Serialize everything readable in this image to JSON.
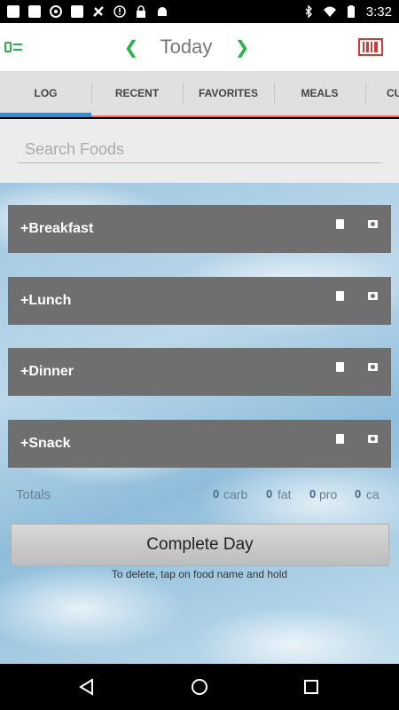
{
  "status_bar": {
    "time": "3:32",
    "left_icons": [
      "facebook-icon",
      "facebook-icon",
      "aperture-icon",
      "facebook-icon",
      "tools-icon",
      "alert-icon",
      "lock-icon",
      "android-icon"
    ],
    "right_icons": [
      "bluetooth-icon",
      "wifi-icon",
      "battery-icon"
    ]
  },
  "appbar": {
    "title": "Today",
    "prev_glyph": "❮",
    "next_glyph": "❯"
  },
  "tabs": [
    {
      "label": "LOG",
      "active": true
    },
    {
      "label": "RECENT",
      "active": false
    },
    {
      "label": "FAVORITES",
      "active": false
    },
    {
      "label": "MEALS",
      "active": false
    },
    {
      "label": "CU",
      "active": false
    }
  ],
  "search": {
    "placeholder": "Search Foods",
    "value": ""
  },
  "meals": [
    {
      "label": "+Breakfast"
    },
    {
      "label": "+Lunch"
    },
    {
      "label": "+Dinner"
    },
    {
      "label": "+Snack"
    }
  ],
  "totals": {
    "label": "Totals",
    "carb_value": "0",
    "carb_unit": "carb",
    "fat_value": "0",
    "fat_unit": "fat",
    "protein_value": "0",
    "protein_unit": "pro",
    "calorie_value": "0",
    "calorie_unit": "ca"
  },
  "actions": {
    "complete_day": "Complete Day",
    "hint": "To delete, tap on food name and hold"
  },
  "colors": {
    "accent_blue": "#2a8fd9",
    "tab_underline": "#ff6e55",
    "meal_bar": "#6f6f6f",
    "icon_green": "#2ab34a"
  }
}
